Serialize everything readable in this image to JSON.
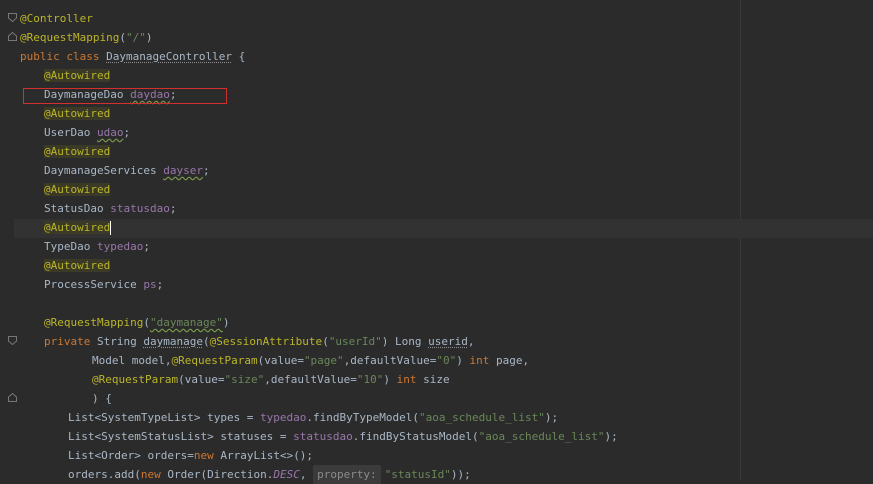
{
  "editor": {
    "language": "java",
    "selected_line": "DaymanageDao daydao;",
    "lines": {
      "l1": {
        "ann": "@Controller"
      },
      "l2": {
        "ann": "@RequestMapping",
        "p1": "(",
        "str": "\"/\"",
        "p2": ")"
      },
      "l3": {
        "kw1": "public",
        "kw2": "class",
        "name": "DaymanageController",
        "rest": " {"
      },
      "l4": {
        "ann": "@Autowired"
      },
      "l5": {
        "type": "DaymanageDao",
        "field": "daydao",
        "semi": ";"
      },
      "l6": {
        "ann": "@Autowired"
      },
      "l7": {
        "type": "UserDao",
        "field": "udao",
        "semi": ";"
      },
      "l8": {
        "ann": "@Autowired"
      },
      "l9": {
        "type": "DaymanageServices",
        "field": "dayser",
        "semi": ";"
      },
      "l10": {
        "ann": "@Autowired"
      },
      "l11": {
        "type": "StatusDao",
        "field": "statusdao",
        "semi": ";"
      },
      "l12": {
        "ann": "@Autowired"
      },
      "l13": {
        "type": "TypeDao",
        "field": "typedao",
        "semi": ";"
      },
      "l14": {
        "ann": "@Autowired"
      },
      "l15": {
        "type": "ProcessService",
        "field": "ps",
        "semi": ";"
      },
      "l17": {
        "ann": "@RequestMapping",
        "p1": "(",
        "str": "\"daymanage\"",
        "p2": ")"
      },
      "l18": {
        "kw1": "private",
        "type": "String",
        "name": "daymanage",
        "p1": "(",
        "ann": "@SessionAttribute",
        "p2": "(",
        "str": "\"userId\"",
        "p3": ") Long ",
        "param": "userid",
        "p4": ","
      },
      "l19": {
        "t1": "Model model,",
        "ann": "@RequestParam",
        "t2": "(value=",
        "str1": "\"page\"",
        "t3": ",defaultValue=",
        "str2": "\"0\"",
        "t4": ") ",
        "kw": "int",
        "t5": " page,"
      },
      "l20": {
        "ann": "@RequestParam",
        "t1": "(value=",
        "str1": "\"size\"",
        "t2": ",defaultValue=",
        "str2": "\"10\"",
        "t3": ") ",
        "kw": "int",
        "t4": " size"
      },
      "l21": {
        "text": ") {"
      },
      "l22": {
        "t1": "List<SystemTypeList> types = ",
        "field": "typedao",
        "t2": ".findByTypeModel(",
        "str": "\"aoa_schedule_list\"",
        "t3": ");"
      },
      "l23": {
        "t1": "List<SystemStatusList> statuses = ",
        "field": "statusdao",
        "t2": ".findByStatusModel(",
        "str": "\"aoa_schedule_list\"",
        "t3": ");"
      },
      "l24": {
        "t1": "List<Order> orders=",
        "kw": "new",
        "t2": " ArrayList<>();"
      },
      "l25": {
        "t1": "orders.add(",
        "kw": "new",
        "t2": " Order(Direction.",
        "const": "DESC",
        "t3": ", ",
        "hint": "property:",
        "str": "\"statusId\"",
        "t4": "));"
      }
    }
  }
}
